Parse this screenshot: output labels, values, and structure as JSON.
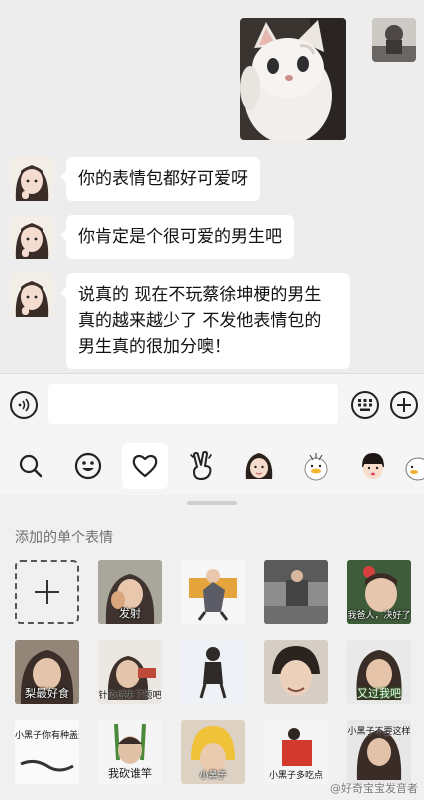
{
  "chat": {
    "messages": [
      {
        "text": "你的表情包都好可爱呀"
      },
      {
        "text": "你肯定是个很可爱的男生吧"
      },
      {
        "lines": [
          "说真的 现在不玩蔡徐坤梗的男生",
          "真的越来越少了 不发他表情包的",
          "男生真的很加分噢！"
        ]
      }
    ]
  },
  "input": {
    "placeholder": ""
  },
  "tabs": [
    "search-icon",
    "smiley-icon",
    "heart-icon",
    "peace-hand-icon",
    "sticker-pack-girl",
    "sticker-pack-duck",
    "sticker-pack-child",
    "sticker-pack-more"
  ],
  "panel": {
    "section_title": "添加的单个表情",
    "sticker_captions": {
      "s1": "发射",
      "s3": "",
      "s4": "",
      "s5": "我爸人，决好了",
      "s6": "梨最好食",
      "s7": "针灸试失了题吧",
      "s8": "",
      "s10": "又过我吧",
      "s11": "小黑子你有种盖这都跟",
      "s12": "我砍谁竿",
      "s13": "小黑子",
      "s14": "小黑子多吃点",
      "s15": "小黑子不要这样"
    }
  },
  "watermark": "@好奇宝宝发音者",
  "colors": {
    "chat_bg": "#ededed",
    "bubble_bg": "#ffffff",
    "panel_bg": "#f0f0f0"
  }
}
